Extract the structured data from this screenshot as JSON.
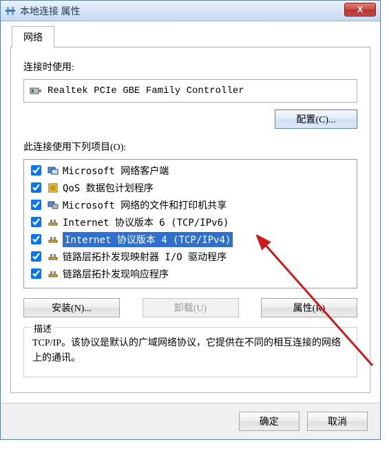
{
  "window": {
    "title": "本地连接 属性",
    "close_glyph": "X"
  },
  "tab": {
    "label": "网络"
  },
  "connect_using": {
    "label": "连接时使用:",
    "adapter": "Realtek PCIe GBE Family Controller"
  },
  "configure_btn": "配置(C)...",
  "items_label": "此连接使用下列项目(O):",
  "items": [
    {
      "checked": true,
      "icon": "client-icon",
      "label": "Microsoft 网络客户端"
    },
    {
      "checked": true,
      "icon": "qos-icon",
      "label": "QoS 数据包计划程序"
    },
    {
      "checked": true,
      "icon": "fileshare-icon",
      "label": "Microsoft 网络的文件和打印机共享"
    },
    {
      "checked": true,
      "icon": "protocol-icon",
      "label": "Internet 协议版本 6 (TCP/IPv6)"
    },
    {
      "checked": true,
      "icon": "protocol-icon",
      "label": "Internet 协议版本 4 (TCP/IPv4)",
      "selected": true
    },
    {
      "checked": true,
      "icon": "protocol-icon",
      "label": "链路层拓扑发现映射器 I/O 驱动程序"
    },
    {
      "checked": true,
      "icon": "protocol-icon",
      "label": "链路层拓扑发现响应程序"
    }
  ],
  "buttons": {
    "install": "安装(N)...",
    "uninstall": "卸载(U)",
    "properties": "属性(R)",
    "ok": "确定",
    "cancel": "取消"
  },
  "description": {
    "title": "描述",
    "body": "TCP/IP。该协议是默认的广域网络协议，它提供在不同的相互连接的网络上的通讯。"
  },
  "annotation": {
    "arrow_color": "#d01818"
  }
}
